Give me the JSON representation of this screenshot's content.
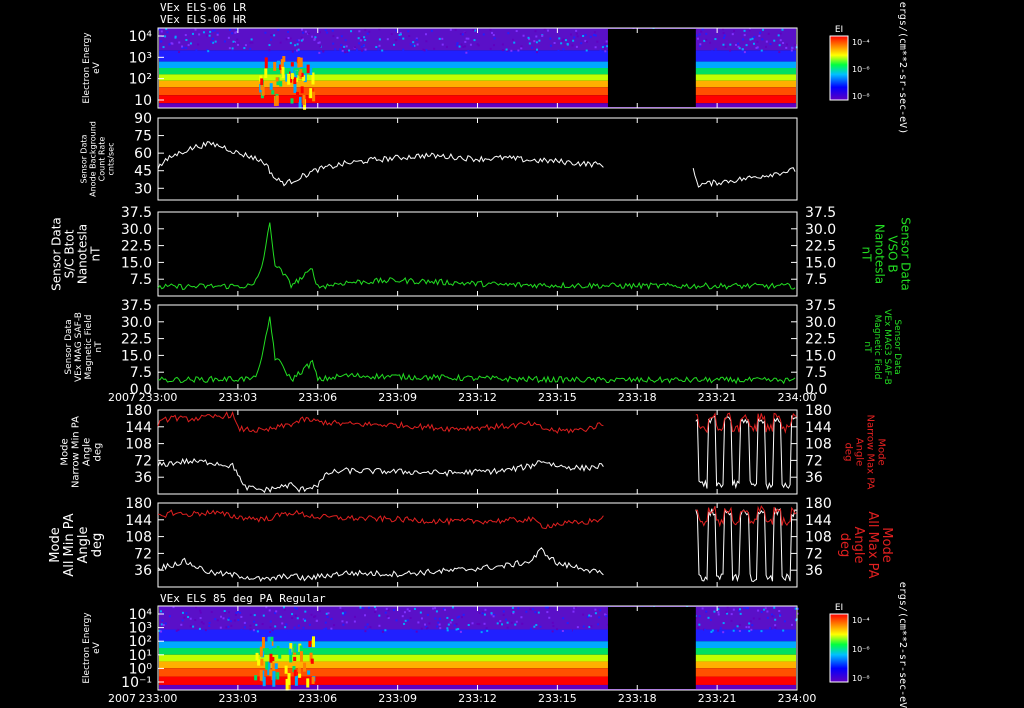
{
  "titles": {
    "top_lr": "VEx ELS-06 LR",
    "top_hr": "VEx ELS-06 HR",
    "bottom": "VEx ELS 85 deg PA Regular",
    "year_mid": "2007",
    "year_bottom": "2007"
  },
  "colors": {
    "white": "#ffffff",
    "green": "#22dd22",
    "red": "#e02020",
    "gap": "#000000"
  },
  "time_axis": {
    "tick_labels": [
      "233:00",
      "233:03",
      "233:06",
      "233:09",
      "233:12",
      "233:15",
      "233:18",
      "233:21",
      "234:00"
    ]
  },
  "chart_data": [
    {
      "type": "heatmap",
      "panel": "electron-spectrogram-top",
      "ylabel": [
        "Electron Energy",
        "eV"
      ],
      "yticks": [
        "10⁴",
        "10³",
        "10²",
        "10"
      ],
      "colorbar": {
        "title": "EI",
        "ticks": [
          "10⁻⁴",
          "10⁻⁶",
          "10⁻⁸"
        ],
        "unit": "ergs/(cm**2-sr-sec-eV)"
      },
      "data_gap": [
        "233:16.9",
        "233:20.2"
      ]
    },
    {
      "type": "line",
      "panel": "anode-background",
      "ylabel": [
        "Sensor Data",
        "Anode Background",
        "Count Rate",
        "cnts/sec"
      ],
      "yticks": [
        "90",
        "75",
        "60",
        "45",
        "30"
      ],
      "ylim": [
        20,
        90
      ],
      "series": [
        {
          "color": "white",
          "points": [
            [
              0,
              48
            ],
            [
              0.5,
              57
            ],
            [
              1,
              62
            ],
            [
              1.5,
              66
            ],
            [
              2,
              68
            ],
            [
              2.5,
              65
            ],
            [
              3,
              60
            ],
            [
              3.5,
              57
            ],
            [
              4,
              52
            ],
            [
              4.4,
              38
            ],
            [
              4.8,
              34
            ],
            [
              5.5,
              41
            ],
            [
              6,
              46
            ],
            [
              7,
              51
            ],
            [
              8,
              54
            ],
            [
              9,
              56
            ],
            [
              10,
              58
            ],
            [
              11,
              57
            ],
            [
              12,
              55
            ],
            [
              13,
              56
            ],
            [
              14,
              54
            ],
            [
              15,
              53
            ],
            [
              16,
              51
            ],
            [
              16.8,
              50
            ]
          ]
        },
        {
          "color": "white",
          "points": [
            [
              20.1,
              45
            ],
            [
              20.3,
              33
            ],
            [
              21,
              35
            ],
            [
              22,
              38
            ],
            [
              23,
              42
            ],
            [
              24,
              46
            ]
          ]
        }
      ]
    },
    {
      "type": "line",
      "panel": "bmag-vso",
      "ylabel": [
        "Sensor Data",
        "S/C Btot",
        "Nanotesla",
        "nT"
      ],
      "ylabel_right": [
        "Sensor Data",
        "VSO B",
        "Nanotesla",
        "nT"
      ],
      "yticks": [
        "37.5",
        "30.0",
        "22.5",
        "15.0",
        "7.5"
      ],
      "ylim": [
        0,
        37.5
      ],
      "series": [
        {
          "color": "green",
          "points": [
            [
              0,
              4
            ],
            [
              3,
              4.5
            ],
            [
              3.6,
              4.5
            ],
            [
              3.9,
              13
            ],
            [
              4.2,
              32
            ],
            [
              4.4,
              14
            ],
            [
              4.7,
              10
            ],
            [
              5,
              5
            ],
            [
              5.4,
              8
            ],
            [
              5.8,
              12
            ],
            [
              6,
              4
            ],
            [
              7,
              6
            ],
            [
              9,
              7
            ],
            [
              11,
              6
            ],
            [
              13,
              5
            ],
            [
              15,
              4.8
            ],
            [
              17,
              4.6
            ],
            [
              19,
              4.5
            ],
            [
              21,
              4.5
            ],
            [
              24,
              4.4
            ]
          ]
        }
      ]
    },
    {
      "type": "line",
      "panel": "bmag-saf",
      "ylabel": [
        "Sensor Data",
        "VEx MAG SAF-B",
        "Magnetic Field",
        "nT"
      ],
      "ylabel_right": [
        "Sensor Data",
        "VEx MAG3 SAF-B",
        "Magnetic Field",
        "nT"
      ],
      "yticks": [
        "37.5",
        "30.0",
        "22.5",
        "15.0",
        "7.5",
        "0.0"
      ],
      "ylim": [
        0,
        37.5
      ],
      "series": [
        {
          "color": "green",
          "points": [
            [
              0,
              4
            ],
            [
              3,
              4.5
            ],
            [
              3.6,
              4.5
            ],
            [
              3.9,
              13
            ],
            [
              4.2,
              32
            ],
            [
              4.4,
              14
            ],
            [
              4.7,
              10
            ],
            [
              5,
              4
            ],
            [
              5.4,
              8
            ],
            [
              5.8,
              12
            ],
            [
              6,
              4
            ],
            [
              7,
              6
            ],
            [
              9,
              5.5
            ],
            [
              11,
              5
            ],
            [
              13,
              4.5
            ],
            [
              15,
              4.2
            ],
            [
              17,
              4
            ],
            [
              19,
              4
            ],
            [
              21,
              4
            ],
            [
              24,
              3.8
            ]
          ]
        }
      ]
    },
    {
      "type": "line",
      "panel": "narrow-pa",
      "ylabel": [
        "Mode",
        "Narrow Min PA",
        "Angle",
        "deg"
      ],
      "ylabel_right": [
        "Mode",
        "Narrow Max PA",
        "Angle",
        "deg"
      ],
      "yticks": [
        "180",
        "144",
        "108",
        "72",
        "36"
      ],
      "ylim": [
        0,
        180
      ],
      "series": [
        {
          "name": "min",
          "color": "white",
          "points": [
            [
              0,
              62
            ],
            [
              1,
              70
            ],
            [
              2,
              68
            ],
            [
              2.8,
              60
            ],
            [
              3,
              45
            ],
            [
              3.2,
              15
            ],
            [
              4,
              8
            ],
            [
              5,
              20
            ],
            [
              5.3,
              8
            ],
            [
              6,
              20
            ],
            [
              6.4,
              45
            ],
            [
              7,
              50
            ],
            [
              9,
              48
            ],
            [
              11,
              45
            ],
            [
              13,
              50
            ],
            [
              14,
              60
            ],
            [
              14.4,
              72
            ],
            [
              15,
              60
            ],
            [
              16,
              55
            ],
            [
              16.8,
              62
            ]
          ]
        },
        {
          "name": "max",
          "color": "red",
          "points": [
            [
              0,
              150
            ],
            [
              0.5,
              165
            ],
            [
              1,
              160
            ],
            [
              2,
              165
            ],
            [
              2.8,
              170
            ],
            [
              3,
              140
            ],
            [
              4,
              135
            ],
            [
              5,
              150
            ],
            [
              5.5,
              160
            ],
            [
              6,
              155
            ],
            [
              7,
              150
            ],
            [
              9,
              148
            ],
            [
              11,
              140
            ],
            [
              13,
              145
            ],
            [
              14,
              150
            ],
            [
              14.5,
              140
            ],
            [
              15,
              135
            ],
            [
              16,
              138
            ],
            [
              16.8,
              152
            ]
          ]
        }
      ]
    },
    {
      "type": "line",
      "panel": "all-pa",
      "ylabel": [
        "Mode",
        "All Min PA",
        "Angle",
        "deg"
      ],
      "ylabel_right": [
        "Mode",
        "All Max PA",
        "Angle",
        "deg"
      ],
      "yticks": [
        "180",
        "144",
        "108",
        "72",
        "36"
      ],
      "ylim": [
        0,
        180
      ],
      "series": [
        {
          "name": "min",
          "color": "white",
          "points": [
            [
              0,
              40
            ],
            [
              1,
              55
            ],
            [
              2,
              30
            ],
            [
              3,
              25
            ],
            [
              4,
              15
            ],
            [
              5,
              25
            ],
            [
              5.5,
              18
            ],
            [
              6,
              22
            ],
            [
              7,
              30
            ],
            [
              9,
              28
            ],
            [
              11,
              35
            ],
            [
              13,
              45
            ],
            [
              14,
              55
            ],
            [
              14.4,
              80
            ],
            [
              15,
              50
            ],
            [
              16,
              40
            ],
            [
              16.8,
              25
            ]
          ]
        },
        {
          "name": "max",
          "color": "red",
          "points": [
            [
              0,
              150
            ],
            [
              0.5,
              160
            ],
            [
              1,
              155
            ],
            [
              2,
              160
            ],
            [
              3,
              150
            ],
            [
              4,
              145
            ],
            [
              5,
              160
            ],
            [
              5.5,
              155
            ],
            [
              6,
              150
            ],
            [
              7,
              148
            ],
            [
              9,
              145
            ],
            [
              11,
              140
            ],
            [
              13,
              142
            ],
            [
              14,
              145
            ],
            [
              14.5,
              130
            ],
            [
              15,
              135
            ],
            [
              16,
              138
            ],
            [
              16.8,
              148
            ]
          ]
        }
      ]
    },
    {
      "type": "heatmap",
      "panel": "electron-spectrogram-bottom",
      "ylabel": [
        "Electron Energy",
        "eV"
      ],
      "yticks": [
        "10⁴",
        "10³",
        "10²",
        "10¹",
        "10⁰",
        "10⁻¹"
      ],
      "colorbar": {
        "title": "EI",
        "ticks": [
          "10⁻⁴",
          "10⁻⁶",
          "10⁻⁸"
        ],
        "unit": "ergs/(cm**2-sr-sec-eV)"
      },
      "data_gap": [
        "233:16.9",
        "233:20.2"
      ]
    }
  ]
}
